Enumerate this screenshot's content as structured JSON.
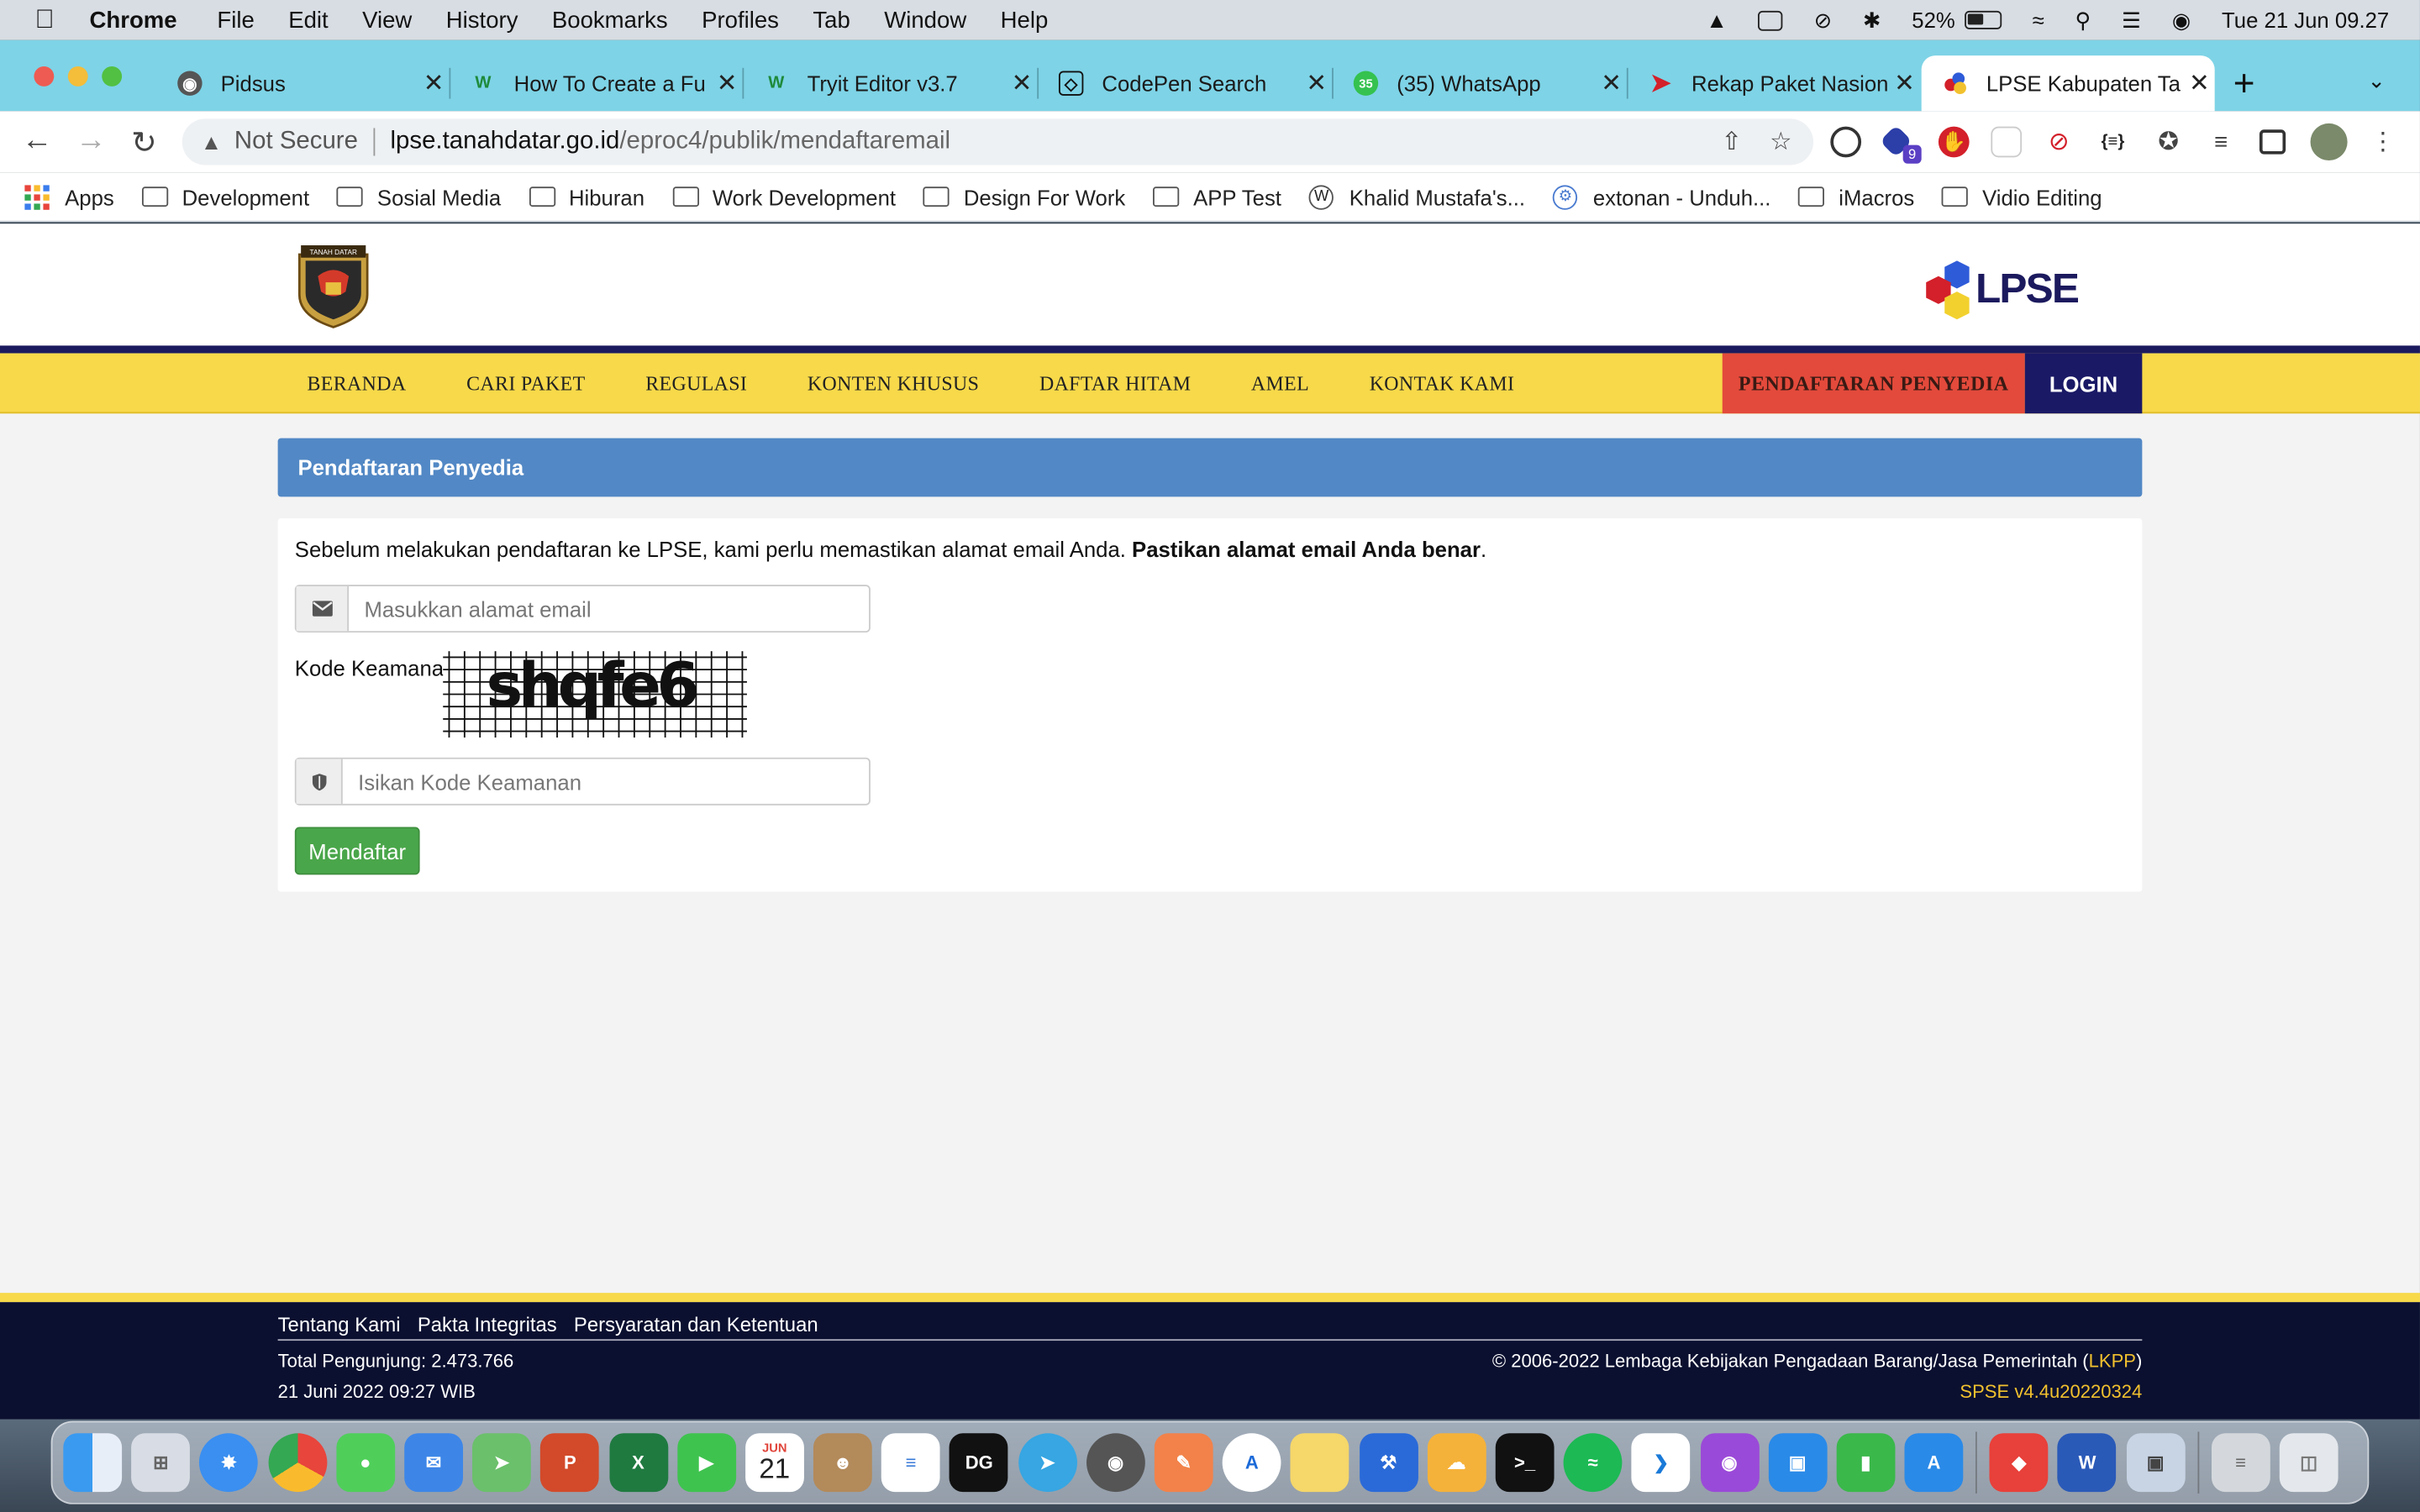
{
  "menubar": {
    "app": "Chrome",
    "items": [
      "File",
      "Edit",
      "View",
      "History",
      "Bookmarks",
      "Profiles",
      "Tab",
      "Window",
      "Help"
    ],
    "battery": "52%",
    "clock": "Tue 21 Jun  09.27"
  },
  "tabs": [
    {
      "label": "Pidsus",
      "icon": "globe-icon"
    },
    {
      "label": "How To Create a Fu",
      "icon": "w-icon"
    },
    {
      "label": "Tryit Editor v3.7",
      "icon": "w-icon"
    },
    {
      "label": "CodePen Search",
      "icon": "codepen-icon"
    },
    {
      "label": "(35) WhatsApp",
      "icon": "whatsapp-icon",
      "badge": "35"
    },
    {
      "label": "Rekap Paket Nasion",
      "icon": "arrow-icon"
    },
    {
      "label": "LPSE Kabupaten Ta",
      "icon": "lpse-icon",
      "active": true
    }
  ],
  "address": {
    "security": "Not Secure",
    "host": "lpse.tanahdatar.go.id",
    "path": "/eproc4/publik/mendaftaremail"
  },
  "extensions": {
    "badge": "9"
  },
  "bookmarks": [
    {
      "label": "Apps",
      "icon": "apps-grid-icon"
    },
    {
      "label": "Development",
      "icon": "folder-icon"
    },
    {
      "label": "Sosial Media",
      "icon": "folder-icon"
    },
    {
      "label": "Hiburan",
      "icon": "folder-icon"
    },
    {
      "label": "Work Development",
      "icon": "folder-icon"
    },
    {
      "label": "Design For Work",
      "icon": "folder-icon"
    },
    {
      "label": "APP Test",
      "icon": "folder-icon"
    },
    {
      "label": "Khalid Mustafa's...",
      "icon": "wordpress-icon"
    },
    {
      "label": "extonan - Unduh...",
      "icon": "gear-icon"
    },
    {
      "label": "iMacros",
      "icon": "folder-icon"
    },
    {
      "label": "Vidio Editing",
      "icon": "folder-icon"
    }
  ],
  "site": {
    "crest_text": "TANAH DATAR",
    "logo_text": "LPSE",
    "nav": [
      "BERANDA",
      "CARI PAKET",
      "REGULASI",
      "KONTEN KHUSUS",
      "DAFTAR HITAM",
      "AMEL",
      "KONTAK KAMI"
    ],
    "register": "PENDAFTARAN PENYEDIA",
    "login": "LOGIN"
  },
  "form": {
    "heading": "Pendaftaran Penyedia",
    "intro": "Sebelum melakukan pendaftaran ke LPSE, kami perlu memastikan alamat email Anda.",
    "intro_bold": "Pastikan alamat email Anda benar",
    "intro_end": ".",
    "email_placeholder": "Masukkan alamat email",
    "captcha_label": "Kode Keamanan",
    "captcha_text": "shqfe6",
    "code_placeholder": "Isikan Kode Keamanan",
    "submit": "Mendaftar"
  },
  "footer": {
    "links": [
      "Tentang Kami",
      "Pakta Integritas",
      "Persyaratan dan Ketentuan"
    ],
    "visitors": "Total Pengunjung: 2.473.766",
    "datetime": "21 Juni 2022 09:27 WIB",
    "copyright_pre": "© 2006-2022 Lembaga Kebijakan Pengadaan Barang/Jasa Pemerintah (",
    "copyright_link": "LKPP",
    "copyright_post": ")",
    "version": "SPSE v4.4u20220324"
  },
  "dock": {
    "calendar_month": "JUN",
    "calendar_day": "21",
    "apps": [
      "finder-icon",
      "launchpad-icon",
      "safari-icon",
      "chrome-icon",
      "messages-icon",
      "mail-icon",
      "maps-icon",
      "powerpoint-icon",
      "excel-icon",
      "facetime-icon",
      "calendar-icon",
      "contacts-icon",
      "reminders-icon",
      "datagrip-icon",
      "telegram-icon",
      "tableplus-icon",
      "pencil-icon",
      "typora-icon",
      "notes-icon",
      "xcode-icon",
      "cyberduck-icon",
      "terminal-icon",
      "spotify-icon",
      "vscode-icon",
      "podcasts-icon",
      "keynote-icon",
      "numbers-icon",
      "appstore-icon",
      "anydesk-icon",
      "word-icon",
      "preview-icon",
      "downloads-icon",
      "trash-icon"
    ]
  }
}
